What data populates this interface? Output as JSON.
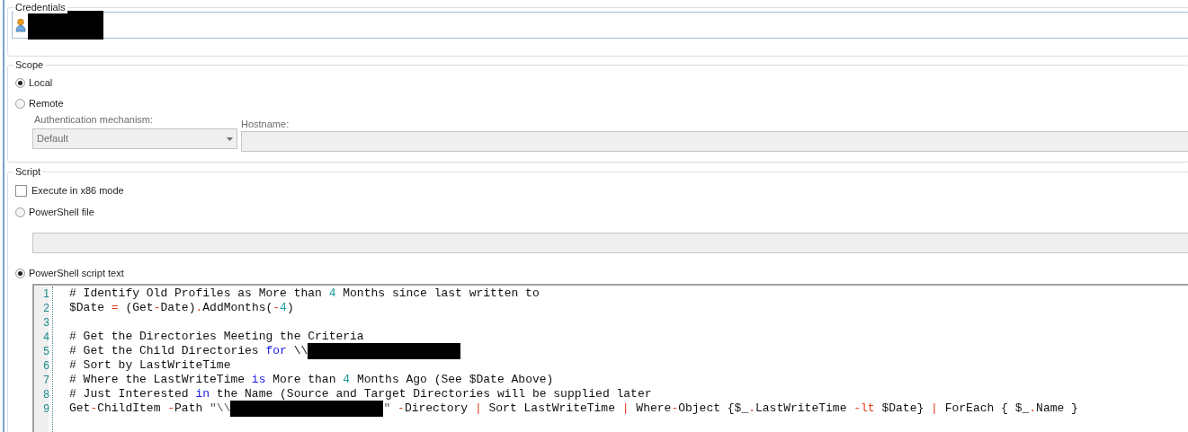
{
  "credentials": {
    "title": "Credentials",
    "account_redacted": true
  },
  "scope": {
    "title": "Scope",
    "options": [
      {
        "label": "Local",
        "selected": true
      },
      {
        "label": "Remote",
        "selected": false
      }
    ],
    "auth_label": "Authentication mechanism:",
    "auth_value": "Default",
    "hostname_label": "Hostname:"
  },
  "script": {
    "title": "Script",
    "x86": {
      "label": "Execute in x86 mode",
      "checked": false
    },
    "options": [
      {
        "label": "PowerShell file",
        "selected": false
      },
      {
        "label": "PowerShell script text",
        "selected": true
      }
    ],
    "lines": [
      {
        "number": "1",
        "tokens": [
          {
            "kind": "plain",
            "text": "# Identify Old Profiles as More than "
          },
          {
            "kind": "number",
            "text": "4"
          },
          {
            "kind": "plain",
            "text": " Months since last written to"
          }
        ]
      },
      {
        "number": "2",
        "tokens": [
          {
            "kind": "plain",
            "text": "$Date "
          },
          {
            "kind": "operator",
            "text": "="
          },
          {
            "kind": "plain",
            "text": " (Get"
          },
          {
            "kind": "operator",
            "text": "-"
          },
          {
            "kind": "plain",
            "text": "Date)"
          },
          {
            "kind": "operator",
            "text": "."
          },
          {
            "kind": "plain",
            "text": "AddMonths("
          },
          {
            "kind": "operator",
            "text": "-"
          },
          {
            "kind": "number",
            "text": "4"
          },
          {
            "kind": "plain",
            "text": ")"
          }
        ]
      },
      {
        "number": "3"
      },
      {
        "number": "4",
        "tokens": [
          {
            "kind": "plain",
            "text": "# Get the Directories Meeting the Criteria"
          }
        ]
      },
      {
        "number": "5",
        "tokens": [
          {
            "kind": "plain",
            "text": "# Get the Child Directories "
          },
          {
            "kind": "keyword",
            "text": "for"
          },
          {
            "kind": "plain",
            "text": " \\\\"
          },
          {
            "kind": "redacted"
          }
        ]
      },
      {
        "number": "6",
        "tokens": [
          {
            "kind": "plain",
            "text": "# Sort by LastWriteTime"
          }
        ]
      },
      {
        "number": "7",
        "tokens": [
          {
            "kind": "plain",
            "text": "# Where the LastWriteTime "
          },
          {
            "kind": "keyword",
            "text": "is"
          },
          {
            "kind": "plain",
            "text": " More than "
          },
          {
            "kind": "number",
            "text": "4"
          },
          {
            "kind": "plain",
            "text": " Months Ago (See $Date Above)"
          }
        ]
      },
      {
        "number": "8",
        "tokens": [
          {
            "kind": "plain",
            "text": "# Just Interested "
          },
          {
            "kind": "keyword",
            "text": "in"
          },
          {
            "kind": "plain",
            "text": " the Name (Source and Target Directories will be supplied later"
          }
        ]
      },
      {
        "number": "9",
        "tokens": [
          {
            "kind": "plain",
            "text": "Get"
          },
          {
            "kind": "operator",
            "text": "-"
          },
          {
            "kind": "plain",
            "text": "ChildItem "
          },
          {
            "kind": "operator",
            "text": "-"
          },
          {
            "kind": "plain",
            "text": "Path "
          },
          {
            "kind": "string",
            "text": "\"\\\\"
          },
          {
            "kind": "redacted"
          },
          {
            "kind": "string",
            "text": "\" "
          },
          {
            "kind": "operator",
            "text": "-"
          },
          {
            "kind": "plain",
            "text": "Directory "
          },
          {
            "kind": "operator",
            "text": "|"
          },
          {
            "kind": "plain",
            "text": " Sort LastWriteTime "
          },
          {
            "kind": "operator",
            "text": "|"
          },
          {
            "kind": "plain",
            "text": " Where"
          },
          {
            "kind": "operator",
            "text": "-"
          },
          {
            "kind": "plain",
            "text": "Object {$_"
          },
          {
            "kind": "operator",
            "text": "."
          },
          {
            "kind": "plain",
            "text": "LastWriteTime "
          },
          {
            "kind": "operator",
            "text": "-lt"
          },
          {
            "kind": "plain",
            "text": " $Date} "
          },
          {
            "kind": "operator",
            "text": "|"
          },
          {
            "kind": "plain",
            "text": " ForEach { $_"
          },
          {
            "kind": "operator",
            "text": "."
          },
          {
            "kind": "plain",
            "text": "Name }"
          }
        ]
      }
    ]
  }
}
